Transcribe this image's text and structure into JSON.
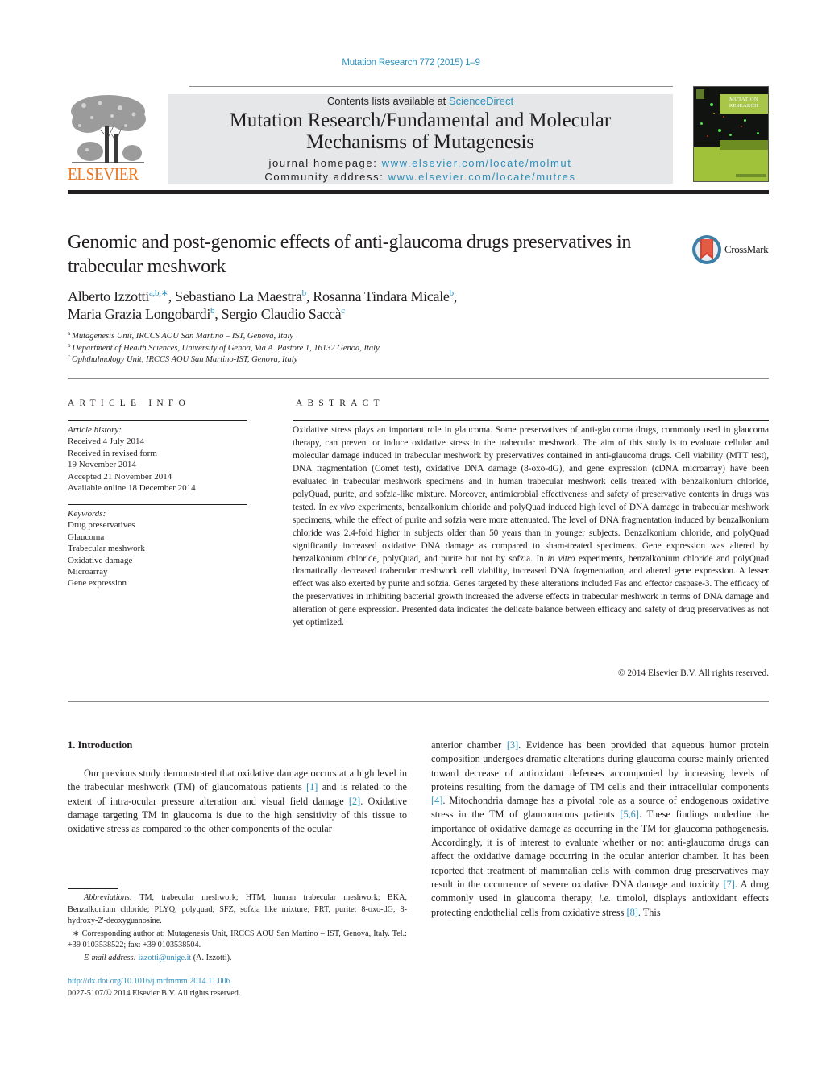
{
  "citation": "Mutation Research 772 (2015) 1–9",
  "header": {
    "publisher_wordmark": "ELSEVIER",
    "contents_prefix": "Contents lists available at ",
    "contents_link": "ScienceDirect",
    "journal_title_line1": "Mutation Research/Fundamental and Molecular",
    "journal_title_line2": "Mechanisms of Mutagenesis",
    "homepage_prefix": "journal homepage: ",
    "homepage_link": "www.elsevier.com/locate/molmut",
    "community_prefix": "Community address: ",
    "community_link": "www.elsevier.com/locate/mutres",
    "cover_title_line1": "MUTATION",
    "cover_title_line2": "RESEARCH"
  },
  "article": {
    "title": "Genomic and post-genomic effects of anti-glaucoma drugs preservatives in trabecular meshwork",
    "crossmark_label": "CrossMark",
    "authors": [
      {
        "name": "Alberto Izzotti",
        "sup": "a,b,∗",
        "sep": ", "
      },
      {
        "name": "Sebastiano La Maestra",
        "sup": "b",
        "sep": ", "
      },
      {
        "name": "Rosanna Tindara Micale",
        "sup": "b",
        "sep": ","
      },
      {
        "name": "Maria Grazia Longobardi",
        "sup": "b",
        "sep": ", "
      },
      {
        "name": "Sergio Claudio Saccà",
        "sup": "c",
        "sep": ""
      }
    ],
    "affiliations": [
      {
        "key": "a",
        "text": "Mutagenesis Unit, IRCCS AOU San Martino – IST, Genova, Italy"
      },
      {
        "key": "b",
        "text": "Department of Health Sciences, University of Genoa, Via A. Pastore 1, 16132 Genoa, Italy"
      },
      {
        "key": "c",
        "text": "Ophthalmology Unit, IRCCS AOU San Martino-IST, Genova, Italy"
      }
    ]
  },
  "article_info": {
    "heading": "ARTICLE INFO",
    "history_label": "Article history:",
    "history": [
      "Received 4 July 2014",
      "Received in revised form",
      "19 November 2014",
      "Accepted 21 November 2014",
      "Available online 18 December 2014"
    ],
    "keywords_label": "Keywords:",
    "keywords": [
      "Drug preservatives",
      "Glaucoma",
      "Trabecular meshwork",
      "Oxidative damage",
      "Microarray",
      "Gene expression"
    ]
  },
  "abstract": {
    "heading": "ABSTRACT",
    "part1": "Oxidative stress plays an important role in glaucoma. Some preservatives of anti-glaucoma drugs, commonly used in glaucoma therapy, can prevent or induce oxidative stress in the trabecular meshwork. The aim of this study is to evaluate cellular and molecular damage induced in trabecular meshwork by preservatives contained in anti-glaucoma drugs. Cell viability (MTT test), DNA fragmentation (Comet test), oxidative DNA damage (8-oxo-dG), and gene expression (cDNA microarray) have been evaluated in trabecular meshwork specimens and in human trabecular meshwork cells treated with benzalkonium chloride, polyQuad, purite, and sofzia-like mixture. Moreover, antimicrobial effectiveness and safety of preservative contents in drugs was tested. In ",
    "italic1": "ex vivo",
    "part2": " experiments, benzalkonium chloride and polyQuad induced high level of DNA damage in trabecular meshwork specimens, while the effect of purite and sofzia were more attenuated. The level of DNA fragmentation induced by benzalkonium chloride was 2.4-fold higher in subjects older than 50 years than in younger subjects. Benzalkonium chloride, and polyQuad significantly increased oxidative DNA damage as compared to sham-treated specimens. Gene expression was altered by benzalkonium chloride, polyQuad, and purite but not by sofzia. In ",
    "italic2": "in vitro",
    "part3": " experiments, benzalkonium chloride and polyQuad dramatically decreased trabecular meshwork cell viability, increased DNA fragmentation, and altered gene expression. A lesser effect was also exerted by purite and sofzia. Genes targeted by these alterations included Fas and effector caspase-3. The efficacy of the preservatives in inhibiting bacterial growth increased the adverse effects in trabecular meshwork in terms of DNA damage and alteration of gene expression. Presented data indicates the delicate balance between efficacy and safety of drug preservatives as not yet optimized.",
    "copyright": "© 2014 Elsevier B.V. All rights reserved."
  },
  "introduction": {
    "heading": "1.  Introduction",
    "left": {
      "t1": "Our previous study demonstrated that oxidative damage occurs at a high level in the trabecular meshwork (TM) of glaucomatous patients ",
      "r1": "[1]",
      "t2": " and is related to the extent of intra-ocular pressure alteration and visual field damage ",
      "r2": "[2]",
      "t3": ". Oxidative damage targeting TM in glaucoma is due to the high sensitivity of this tissue to oxidative stress as compared to the other components of the ocular"
    },
    "right": {
      "t1": "anterior chamber ",
      "r3": "[3]",
      "t2": ". Evidence has been provided that aqueous humor protein composition undergoes dramatic alterations during glaucoma course mainly oriented toward decrease of antioxidant defenses accompanied by increasing levels of proteins resulting from the damage of TM cells and their intracellular components ",
      "r4": "[4]",
      "t3": ". Mitochondria damage has a pivotal role as a source of endogenous oxidative stress in the TM of glaucomatous patients ",
      "r56": "[5,6]",
      "t4": ". These findings underline the importance of oxidative damage as occurring in the TM for glaucoma pathogenesis. Accordingly, it is of interest to evaluate whether or not anti-glaucoma drugs can affect the oxidative damage occurring in the ocular anterior chamber. It has been reported that treatment of mammalian cells with common drug preservatives may result in the occurrence of severe oxidative DNA damage and toxicity ",
      "r7": "[7]",
      "t5": ". A drug commonly used in glaucoma therapy, ",
      "ie": "i.e.",
      "t6": " timolol, displays antioxidant effects protecting endothelial cells from oxidative stress ",
      "r8": "[8]",
      "t7": ". This"
    }
  },
  "footnotes": {
    "abbrev_label": "Abbreviations:",
    "abbrev_text": "  TM, trabecular meshwork; HTM, human trabecular meshwork; BKA, Benzalkonium chloride; PLYQ, polyquad; SFZ, sofzia like mixture; PRT, purite; 8-oxo-dG, 8-hydroxy-2′-deoxyguanosine.",
    "corresponding": "∗  Corresponding author at: Mutagenesis Unit, IRCCS AOU San Martino – IST, Genova, Italy. Tel.: +39 0103538522; fax: +39 0103538504.",
    "email_label": "E-mail address: ",
    "email": "izzotti@unige.it",
    "email_suffix": " (A. Izzotti).",
    "doi": "http://dx.doi.org/10.1016/j.mrfmmm.2014.11.006",
    "issn_line": "0027-5107/© 2014 Elsevier B.V. All rights reserved."
  },
  "colors": {
    "link": "#2a8fbd",
    "elsevier_orange": "#e87722",
    "header_box": "#e6e7e8",
    "text": "#231f20",
    "cover_green": "#9fc23a",
    "crossmark_red": "#d9402f",
    "crossmark_blue": "#3d7fa6"
  }
}
